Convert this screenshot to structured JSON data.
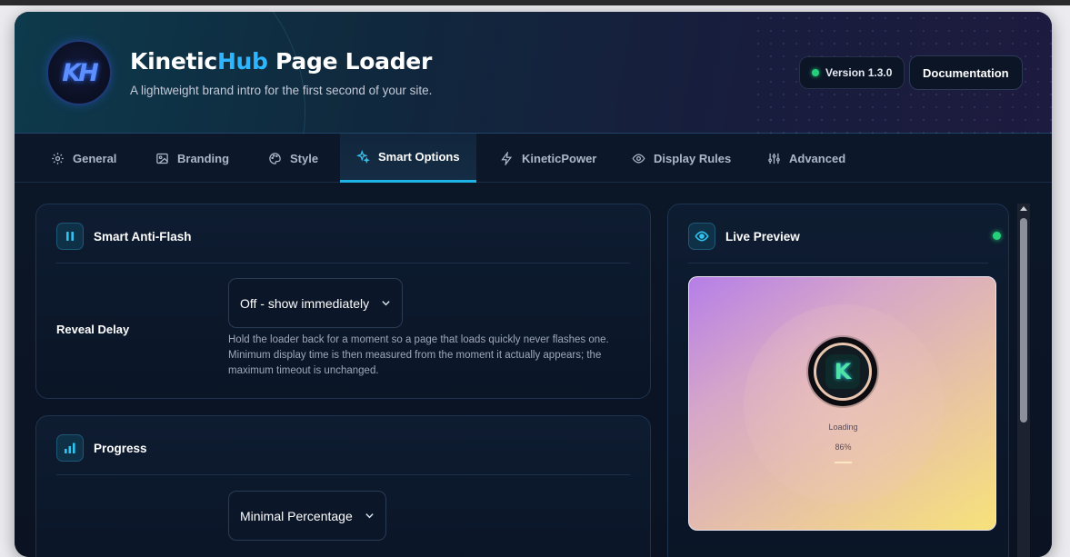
{
  "header": {
    "logo_text": "KH",
    "title_part1": "Kinetic",
    "title_accent": "Hub",
    "title_part2": " Page Loader",
    "subtitle": "A lightweight brand intro for the first second of your site.",
    "version_label": "Version 1.3.0",
    "docs_label": "Documentation"
  },
  "tabs": [
    {
      "label": "General",
      "icon": "gear-icon"
    },
    {
      "label": "Branding",
      "icon": "image-icon"
    },
    {
      "label": "Style",
      "icon": "palette-icon"
    },
    {
      "label": "Smart Options",
      "icon": "sparkles-icon",
      "active": true
    },
    {
      "label": "KineticPower",
      "icon": "lightning-icon"
    },
    {
      "label": "Display Rules",
      "icon": "eye-icon"
    },
    {
      "label": "Advanced",
      "icon": "sliders-icon"
    }
  ],
  "anti_flash": {
    "title": "Smart Anti-Flash",
    "icon": "pause-icon",
    "row_label": "Reveal Delay",
    "select_value": "Off - show immediately",
    "description": "Hold the loader back for a moment so a page that loads quickly never flashes one. Minimum display time is then measured from the moment it actually appears; the maximum timeout is unchanged."
  },
  "progress": {
    "title": "Progress",
    "icon": "bar-chart-icon",
    "select_value": "Minimal Percentage"
  },
  "preview": {
    "title": "Live Preview",
    "icon": "eye-icon",
    "loading_label": "Loading",
    "percent_label": "86%",
    "percent_value": 86
  },
  "colors": {
    "accent": "#2eb5ff",
    "active_tab_underline": "#1fb2e6",
    "status_green": "#25d07a"
  }
}
